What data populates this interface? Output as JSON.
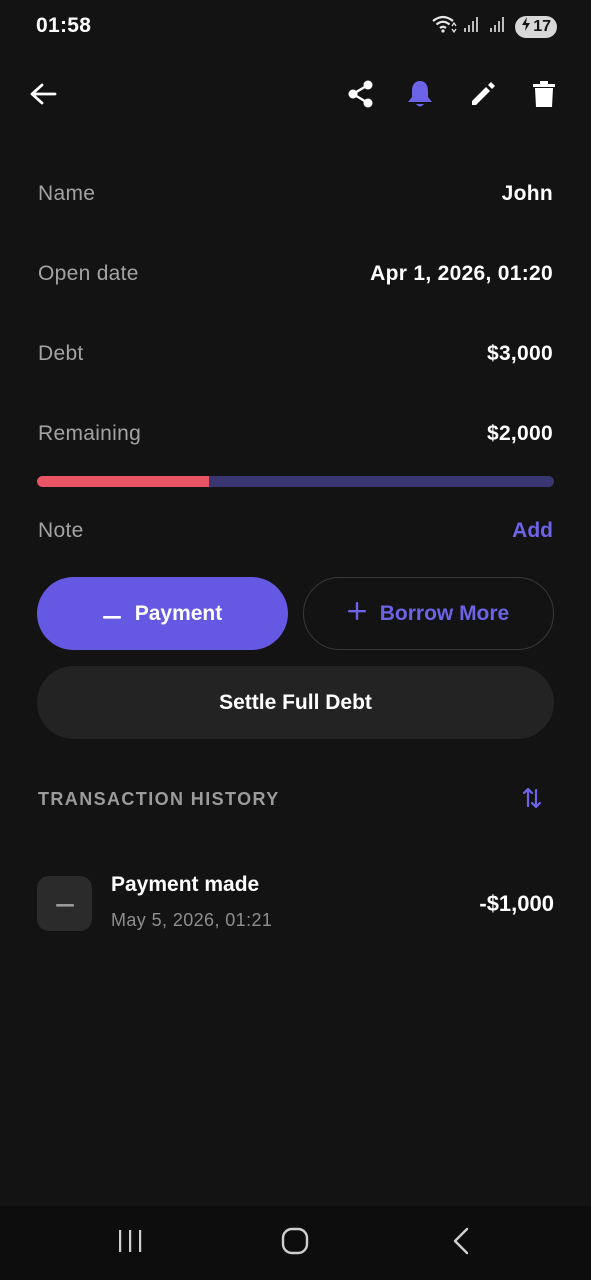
{
  "status_bar": {
    "time": "01:58",
    "battery": "17",
    "icons": [
      "wifi-icon",
      "signal-icon",
      "signal-icon",
      "battery-charging-icon"
    ]
  },
  "toolbar": {
    "back_icon": "arrow-left-icon",
    "actions": [
      "share-icon",
      "bell-icon",
      "pencil-icon",
      "trash-icon"
    ],
    "bell_color": "#6c63e6"
  },
  "details": {
    "name_label": "Name",
    "name_value": "John",
    "open_date_label": "Open date",
    "open_date_value": "Apr 1, 2026, 01:20",
    "debt_label": "Debt",
    "debt_value": "$3,000",
    "remaining_label": "Remaining",
    "remaining_value": "$2,000",
    "paid_fraction": 0.333,
    "note_label": "Note",
    "note_action": "Add"
  },
  "actions": {
    "payment_label": "Payment",
    "borrow_label": "Borrow More",
    "settle_label": "Settle Full Debt"
  },
  "history": {
    "title": "TRANSACTION HISTORY",
    "items": [
      {
        "title": "Payment made",
        "date": "May 5, 2026, 01:21",
        "amount": "-$1,000",
        "icon": "minus-icon"
      }
    ]
  },
  "colors": {
    "accent": "#6559e3",
    "accent_text": "#6c63e6",
    "progress_paid": "#ea5566",
    "progress_track": "#3a3672",
    "background": "#131313"
  }
}
